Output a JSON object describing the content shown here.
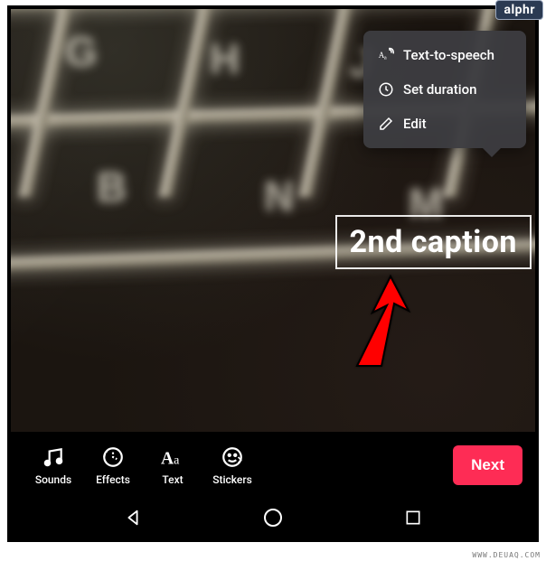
{
  "badge": "alphr",
  "watermark": "WWW.DEUAQ.COM",
  "popup": {
    "items": [
      {
        "label": "Text-to-speech"
      },
      {
        "label": "Set duration"
      },
      {
        "label": "Edit"
      }
    ]
  },
  "caption": {
    "text": "2nd caption"
  },
  "toolbar": {
    "sounds": "Sounds",
    "effects": "Effects",
    "text": "Text",
    "stickers": "Stickers",
    "next": "Next"
  },
  "colors": {
    "accent": "#fe2c55",
    "popup_bg": "#3c3c41"
  }
}
